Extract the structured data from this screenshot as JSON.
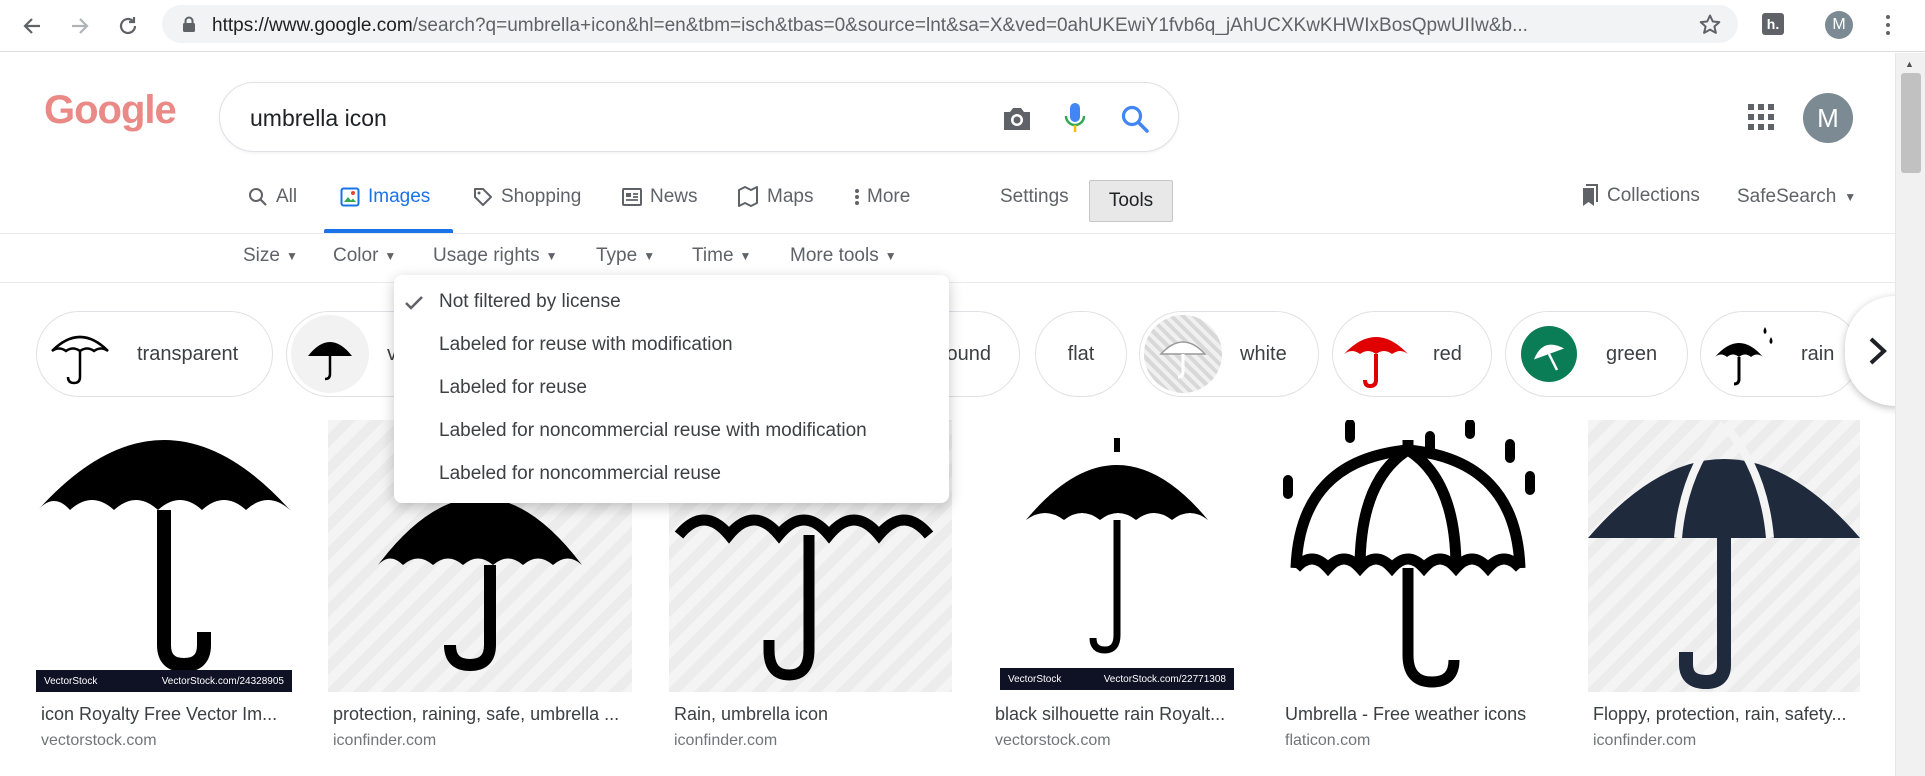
{
  "browser": {
    "url_main": "https://www.google.com",
    "url_rest": "/search?q=umbrella+icon&hl=en&tbm=isch&tbas=0&source=lnt&sa=X&ved=0ahUKEwiY1fvb6q_jAhUCXKwKHWIxBosQpwUIIw&b...",
    "profile_initial": "M"
  },
  "google": {
    "logo_text": "Google",
    "query": "umbrella icon",
    "account_initial": "M"
  },
  "tabs": [
    {
      "label": "All"
    },
    {
      "label": "Images"
    },
    {
      "label": "Shopping"
    },
    {
      "label": "News"
    },
    {
      "label": "Maps"
    },
    {
      "label": "More"
    }
  ],
  "settings_label": "Settings",
  "tools_label": "Tools",
  "collections_label": "Collections",
  "safesearch_label": "SafeSearch",
  "filters": [
    "Size",
    "Color",
    "Usage rights",
    "Type",
    "Time",
    "More tools"
  ],
  "usage_menu": [
    {
      "label": "Not filtered by license",
      "checked": true
    },
    {
      "label": "Labeled for reuse with modification",
      "checked": false
    },
    {
      "label": "Labeled for reuse",
      "checked": false
    },
    {
      "label": "Labeled for noncommercial reuse with modification",
      "checked": false
    },
    {
      "label": "Labeled for noncommercial reuse",
      "checked": false
    }
  ],
  "chips": [
    {
      "label": "transparent"
    },
    {
      "label": "v"
    },
    {
      "label": "ound"
    },
    {
      "label": "flat"
    },
    {
      "label": "white"
    },
    {
      "label": "red"
    },
    {
      "label": "green"
    },
    {
      "label": "rain"
    }
  ],
  "results": [
    {
      "caption": "icon Royalty Free Vector Im...",
      "source": "vectorstock.com",
      "watermark_left": "VectorStock",
      "watermark_right": "VectorStock.com/24328905"
    },
    {
      "caption": "protection, raining, safe, umbrella ...",
      "source": "iconfinder.com"
    },
    {
      "caption": "Rain, umbrella icon",
      "source": "iconfinder.com"
    },
    {
      "caption": "black silhouette rain Royalt...",
      "source": "vectorstock.com",
      "watermark_left": "VectorStock",
      "watermark_right": "VectorStock.com/22771308"
    },
    {
      "caption": "Umbrella - Free weather icons",
      "source": "flaticon.com"
    },
    {
      "caption": "Floppy, protection, rain, safety...",
      "source": "iconfinder.com"
    }
  ],
  "colors": {
    "accent": "#1a73e8",
    "logo": "#ea8a87",
    "chip_red": "#e00000",
    "chip_green": "#0a7c56",
    "icon_navy": "#1f2a3d"
  }
}
